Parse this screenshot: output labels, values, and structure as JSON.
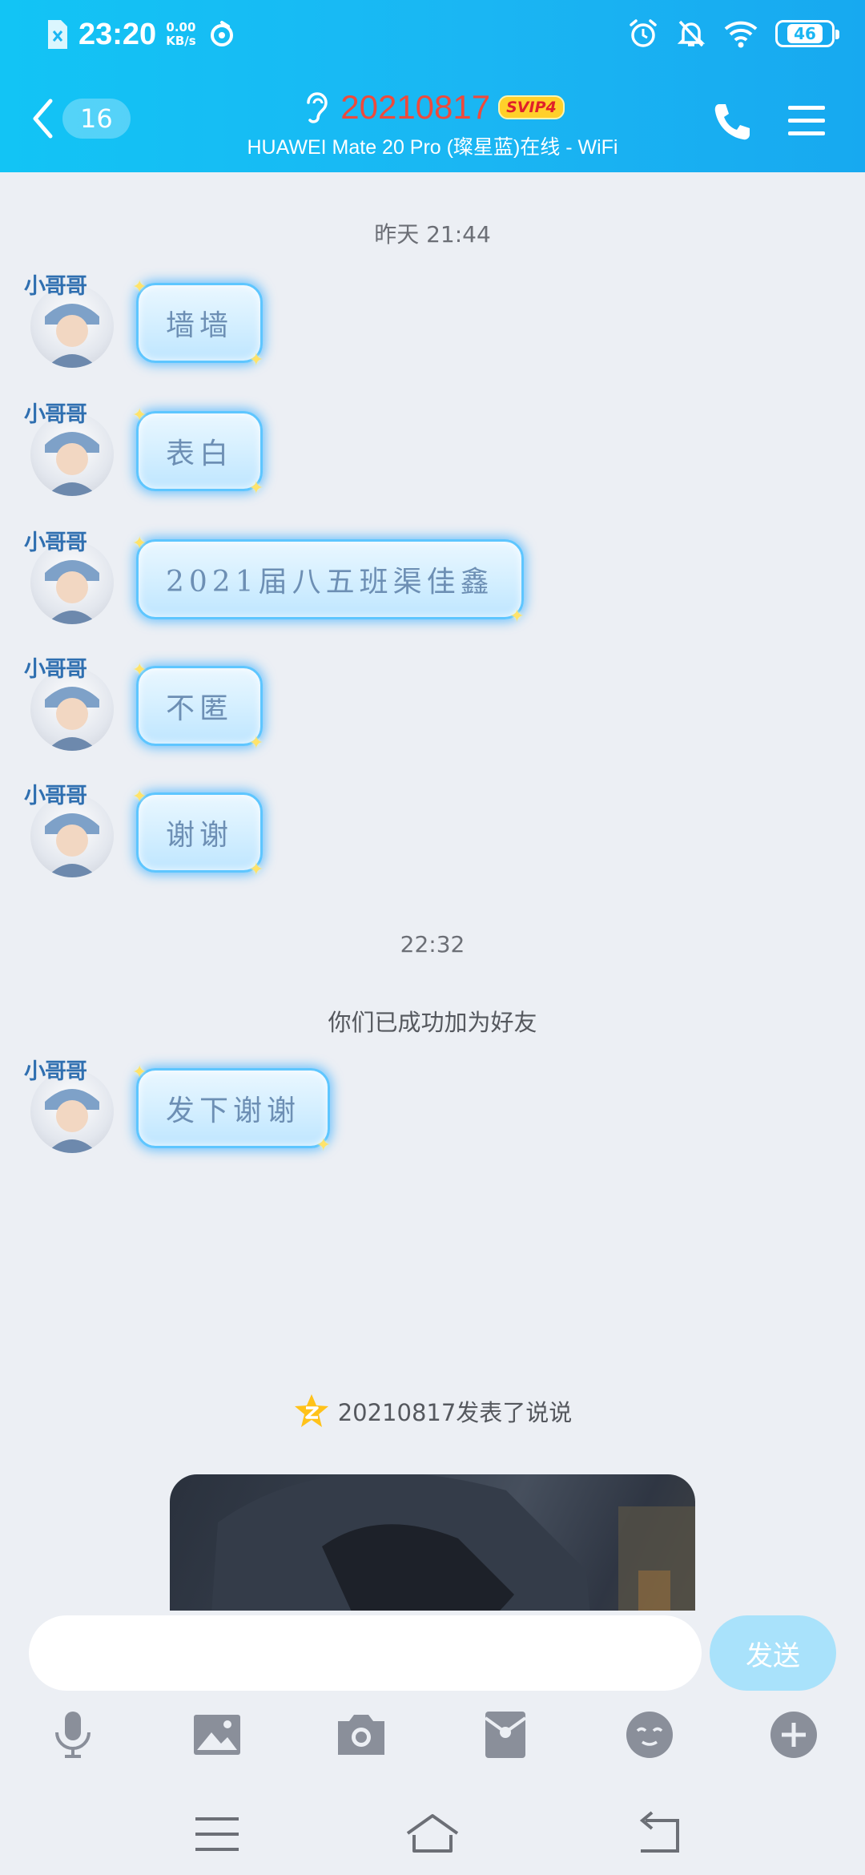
{
  "status_bar": {
    "time": "23:20",
    "speed_value": "0.00",
    "speed_unit": "KB/s",
    "battery": "46"
  },
  "header": {
    "back_count": "16",
    "title": "20210817",
    "vip_badge": "SVIP4",
    "subtitle": "HUAWEI Mate 20 Pro (璨星蓝)在线 - WiFi"
  },
  "colors": {
    "header_start": "#12c4f5",
    "header_end": "#17a9f0",
    "title_red": "#ee4a3c",
    "bubble_glow": "#5ec6ff",
    "send_button": "#a9e2fb"
  },
  "chat": {
    "timestamp_1": "昨天 21:44",
    "avatar_label": "小哥哥",
    "messages": [
      {
        "text": "墙墙"
      },
      {
        "text": "表白"
      },
      {
        "text": "2021届八五班渠佳鑫"
      },
      {
        "text": "不匿"
      },
      {
        "text": "谢谢"
      }
    ],
    "timestamp_2": "22:32",
    "system_notice": "你们已成功加为好友",
    "message_after": {
      "text": "发下谢谢"
    },
    "qzone_notice": "20210817发表了说说"
  },
  "input": {
    "placeholder": "",
    "send_label": "发送"
  },
  "toolbar": {
    "icons": [
      "microphone-icon",
      "image-icon",
      "camera-icon",
      "red-packet-icon",
      "emoji-icon",
      "plus-icon"
    ]
  },
  "system_nav": {
    "icons": [
      "menu-icon",
      "home-icon",
      "back-icon"
    ]
  }
}
